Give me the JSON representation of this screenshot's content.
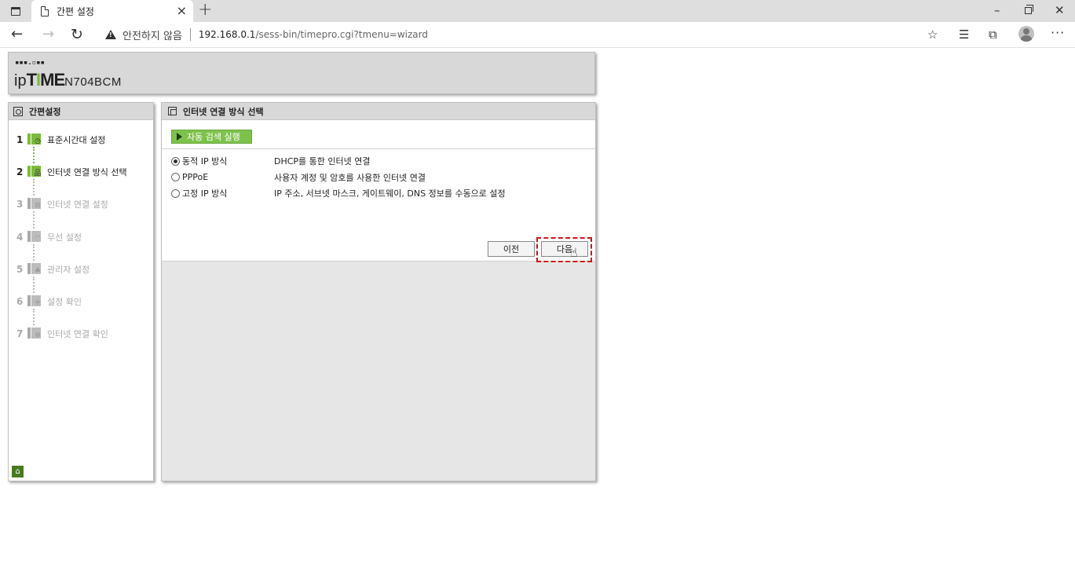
{
  "browser": {
    "tab_title": "간편 설정",
    "tab_close": "×",
    "new_tab": "+",
    "window": {
      "minimize": "–",
      "close": "✕"
    },
    "nav": {
      "back": "←",
      "forward": "→",
      "reload": "↻"
    },
    "security_warning": "안전하지 않음",
    "url_host": "192.168.0.1",
    "url_path": "/sess-bin/timepro.cgi?tmenu=wizard",
    "toolbar_icons": {
      "add_favorite": "☆",
      "favorites": "☰",
      "collections": "⧉",
      "more": "···"
    }
  },
  "logo": {
    "dots": "▪▪▪.▫▪▪",
    "brand_prefix": "ip",
    "brand_main_a": "T",
    "brand_main_hi": "I",
    "brand_main_b": "ME",
    "model": "N704BCM"
  },
  "sidebar": {
    "title": "간편설정",
    "steps": [
      {
        "num": "1",
        "label": "표준시간대 설정",
        "glyph": "◷",
        "state": "active"
      },
      {
        "num": "2",
        "label": "인터넷 연결 방식 선택",
        "glyph": "品",
        "state": "active"
      },
      {
        "num": "3",
        "label": "인터넷 연결 설정",
        "glyph": "⊞",
        "state": "inactive"
      },
      {
        "num": "4",
        "label": "무선 설정",
        "glyph": "◠",
        "state": "inactive"
      },
      {
        "num": "5",
        "label": "관리자 설정",
        "glyph": "♣",
        "state": "inactive"
      },
      {
        "num": "6",
        "label": "설정 확인",
        "glyph": "✢",
        "state": "inactive"
      },
      {
        "num": "7",
        "label": "인터넷 연결 확인",
        "glyph": "⊕",
        "state": "inactive"
      }
    ],
    "home_glyph": "⌂"
  },
  "main": {
    "title": "인터넷 연결 방식 선택",
    "auto_detect_label": "자동 검색 실행",
    "options": [
      {
        "label": "동적 IP 방식",
        "desc": "DHCP를 통한 인터넷 연결",
        "checked": true
      },
      {
        "label": "PPPoE",
        "desc": "사용자 계정 및 암호를 사용한 인터넷 연결",
        "checked": false
      },
      {
        "label": "고정 IP 방식",
        "desc": "IP 주소, 서브넷 마스크, 게이트웨이, DNS 정보를 수동으로 설정",
        "checked": false
      }
    ],
    "prev_label": "이전",
    "next_label": "다음"
  },
  "colors": {
    "accent_green": "#7dbb3b",
    "highlight_red": "#d0141a",
    "panel_gray": "#d8d8d8"
  }
}
